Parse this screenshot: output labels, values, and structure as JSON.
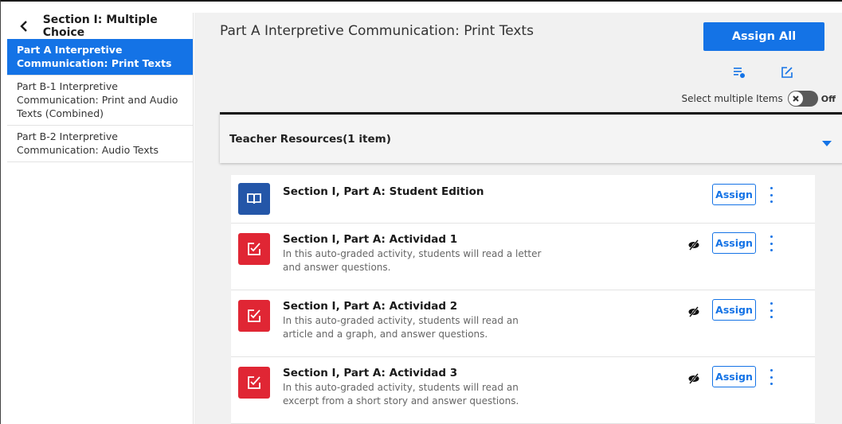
{
  "sidebar": {
    "title": "Section I: Multiple Choice",
    "items": [
      {
        "label": "Part A Interpretive Communication: Print Texts",
        "active": true
      },
      {
        "label": "Part B-1 Interpretive Communication: Print and Audio Texts (Combined)",
        "active": false
      },
      {
        "label": "Part B-2 Interpretive Communication: Audio Texts",
        "active": false
      }
    ]
  },
  "main": {
    "title": "Part A Interpretive Communication: Print Texts",
    "assign_all_label": "Assign All",
    "select_multiple_label": "Select multiple Items",
    "toggle_state": "Off",
    "resources_label": "Teacher Resources(1 item)"
  },
  "items": [
    {
      "title": "Section I, Part A: Student Edition",
      "description": "",
      "icon": "book-icon",
      "hidden": false,
      "assign_label": "Assign"
    },
    {
      "title": "Section I, Part A: Actividad 1",
      "description": "In this auto-graded activity, students will read a letter and answer questions.",
      "icon": "edit-check-icon",
      "hidden": true,
      "assign_label": "Assign"
    },
    {
      "title": "Section I, Part A: Actividad 2",
      "description": "In this auto-graded activity, students will read an article and a graph, and answer questions.",
      "icon": "edit-check-icon",
      "hidden": true,
      "assign_label": "Assign"
    },
    {
      "title": "Section I, Part A: Actividad 3",
      "description": "In this auto-graded activity, students will read an excerpt from a short story and answer questions.",
      "icon": "edit-check-icon",
      "hidden": true,
      "assign_label": "Assign"
    }
  ],
  "colors": {
    "accent": "#1473e6",
    "book_icon_bg": "#2456a8",
    "activity_icon_bg": "#e02634"
  }
}
